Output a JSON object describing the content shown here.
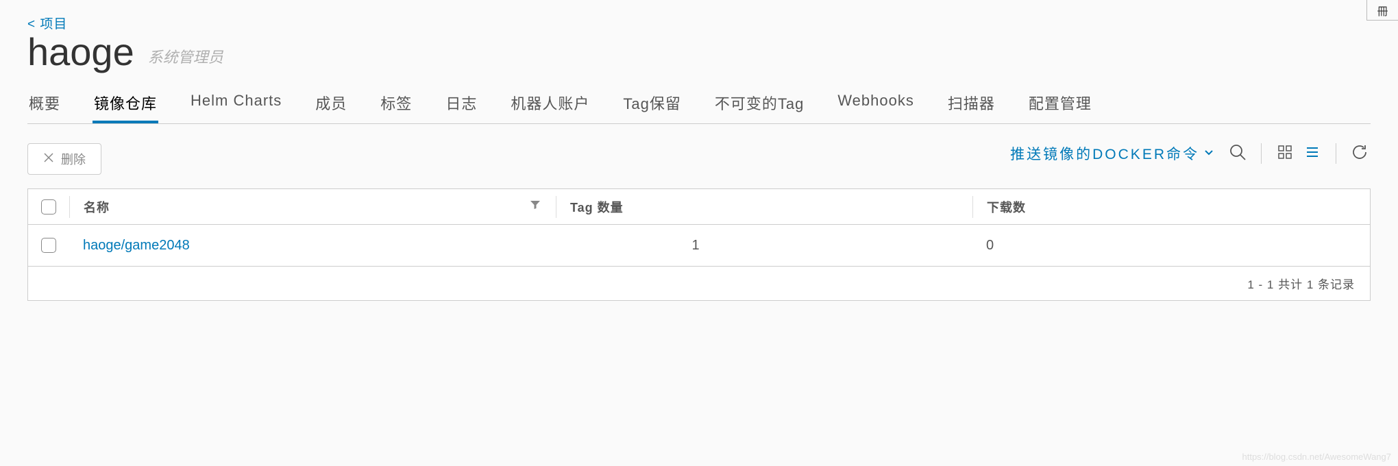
{
  "breadcrumb": "< 项目",
  "project_name": "haoge",
  "role_label": "系统管理员",
  "tabs": [
    "概要",
    "镜像仓库",
    "Helm Charts",
    "成员",
    "标签",
    "日志",
    "机器人账户",
    "Tag保留",
    "不可变的Tag",
    "Webhooks",
    "扫描器",
    "配置管理"
  ],
  "active_tab_index": 1,
  "delete_label": "删除",
  "push_cmd_label": "推送镜像的DOCKER命令",
  "columns": {
    "name": "名称",
    "tag_count": "Tag 数量",
    "downloads": "下载数"
  },
  "rows": [
    {
      "name": "haoge/game2048",
      "tag_count": "1",
      "downloads": "0"
    }
  ],
  "pagination": "1 - 1 共计 1 条记录",
  "watermark": "https://blog.csdn.net/AwesomeWang7",
  "corner_glyph": "冊"
}
